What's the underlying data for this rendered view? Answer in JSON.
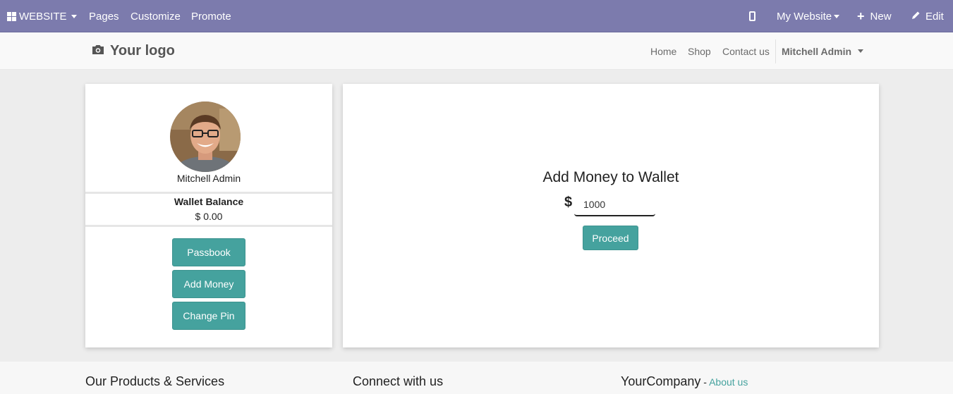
{
  "topbar": {
    "app_menu_label": "WEBSITE",
    "menu_items": [
      "Pages",
      "Customize",
      "Promote"
    ],
    "website_selector": "My Website",
    "new_label": "New",
    "edit_label": "Edit",
    "background_color": "#7c7bad"
  },
  "header": {
    "logo_text": "Your logo",
    "nav_items": [
      "Home",
      "Shop",
      "Contact us"
    ],
    "user_menu": "Mitchell Admin"
  },
  "profile": {
    "name": "Mitchell Admin",
    "wallet_balance_label": "Wallet Balance",
    "wallet_balance_value": "$ 0.00",
    "buttons": [
      "Passbook",
      "Add Money",
      "Change Pin"
    ]
  },
  "add_money": {
    "title": "Add Money to Wallet",
    "currency_symbol": "$",
    "amount_value": "1000",
    "proceed_label": "Proceed"
  },
  "footer": {
    "col1_title": "Our Products & Services",
    "col2_title": "Connect with us",
    "col3_title": "YourCompany",
    "col3_separator": " - ",
    "col3_link": "About us"
  },
  "colors": {
    "accent": "#45a29e",
    "link": "#45a29e"
  }
}
